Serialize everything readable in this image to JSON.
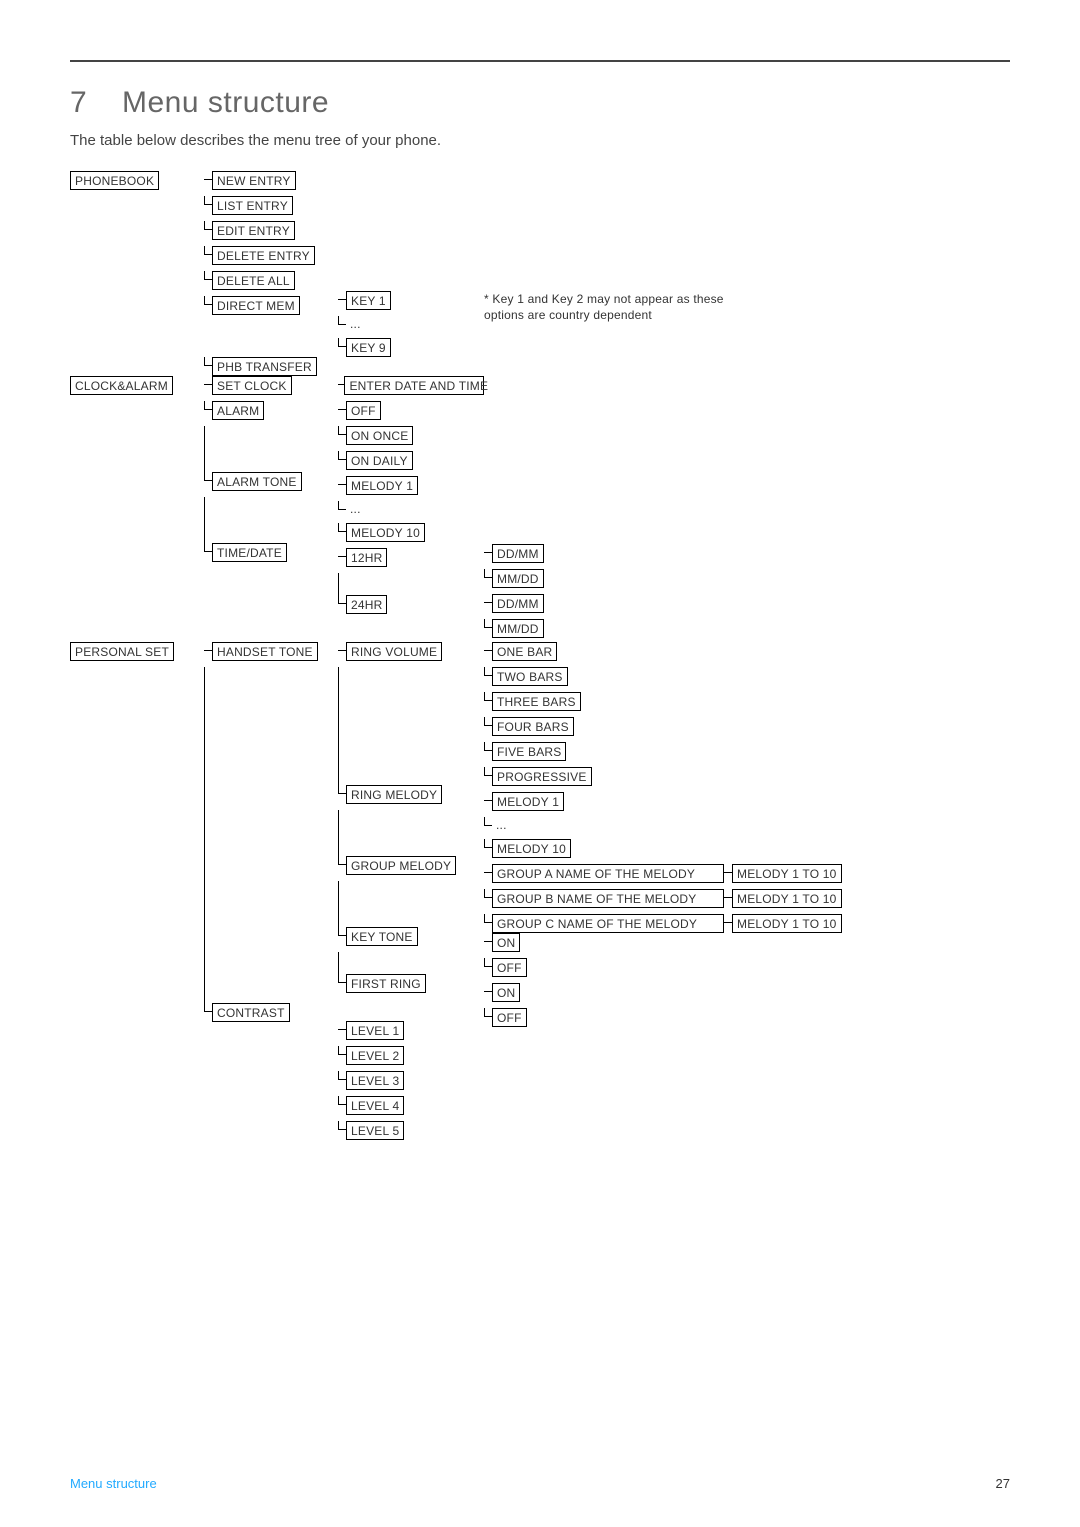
{
  "page": {
    "section_number": "7",
    "title": "Menu structure",
    "intro": "The table below describes the menu tree of your phone.",
    "footer_left": "Menu structure",
    "footer_right": "27"
  },
  "note": "* Key 1 and Key 2 may not appear as these options are country dependent",
  "tree": {
    "phonebook": {
      "label": "PHONEBOOK",
      "items": {
        "new_entry": "NEW ENTRY",
        "list_entry": "LIST ENTRY",
        "edit_entry": "EDIT ENTRY",
        "delete_entry": "DELETE ENTRY",
        "delete_all": "DELETE ALL",
        "direct_mem": "DIRECT MEM",
        "direct_mem_sub": {
          "k1": "KEY 1",
          "dots": "...",
          "k9": "KEY 9"
        },
        "phb_transfer": "PHB TRANSFER"
      }
    },
    "clock_alarm": {
      "label": "CLOCK&ALARM",
      "set_clock": "SET CLOCK",
      "set_clock_sub": "ENTER DATE AND TIME",
      "alarm": "ALARM",
      "alarm_sub": {
        "off": "OFF",
        "on_once": "ON ONCE",
        "on_daily": "ON DAILY"
      },
      "alarm_tone": "ALARM TONE",
      "alarm_tone_sub": {
        "m1": "MELODY 1",
        "dots": "...",
        "m10": "MELODY 10"
      },
      "time_date": "TIME/DATE",
      "time_date_sub": {
        "h12": "12HR",
        "h12_a": "DD/MM",
        "h12_b": "MM/DD",
        "h24": "24HR",
        "h24_a": "DD/MM",
        "h24_b": "MM/DD"
      }
    },
    "personal_set": {
      "label": "PERSONAL SET",
      "handset_tone": "HANDSET TONE",
      "ring_volume": "RING VOLUME",
      "ring_volume_sub": {
        "b1": "ONE BAR",
        "b2": "TWO BARS",
        "b3": "THREE BARS",
        "b4": "FOUR BARS",
        "b5": "FIVE BARS",
        "prog": "PROGRESSIVE"
      },
      "ring_melody": "RING MELODY",
      "ring_melody_sub": {
        "m1": "MELODY 1",
        "dots": "...",
        "m10": "MELODY 10"
      },
      "group_melody": "GROUP MELODY",
      "group_melody_sub": {
        "ga": "GROUP A NAME OF THE MELODY",
        "ga_r": "MELODY 1 TO 10",
        "gb": "GROUP B NAME OF THE MELODY",
        "gb_r": "MELODY 1 TO 10",
        "gc": "GROUP C NAME OF THE MELODY",
        "gc_r": "MELODY 1 TO 10"
      },
      "key_tone": "KEY TONE",
      "key_tone_sub": {
        "on": "ON",
        "off": "OFF"
      },
      "first_ring": "FIRST RING",
      "first_ring_sub": {
        "on": "ON",
        "off": "OFF"
      },
      "contrast": "CONTRAST",
      "contrast_sub": {
        "l1": "LEVEL 1",
        "l2": "LEVEL 2",
        "l3": "LEVEL 3",
        "l4": "LEVEL 4",
        "l5": "LEVEL 5"
      }
    }
  }
}
